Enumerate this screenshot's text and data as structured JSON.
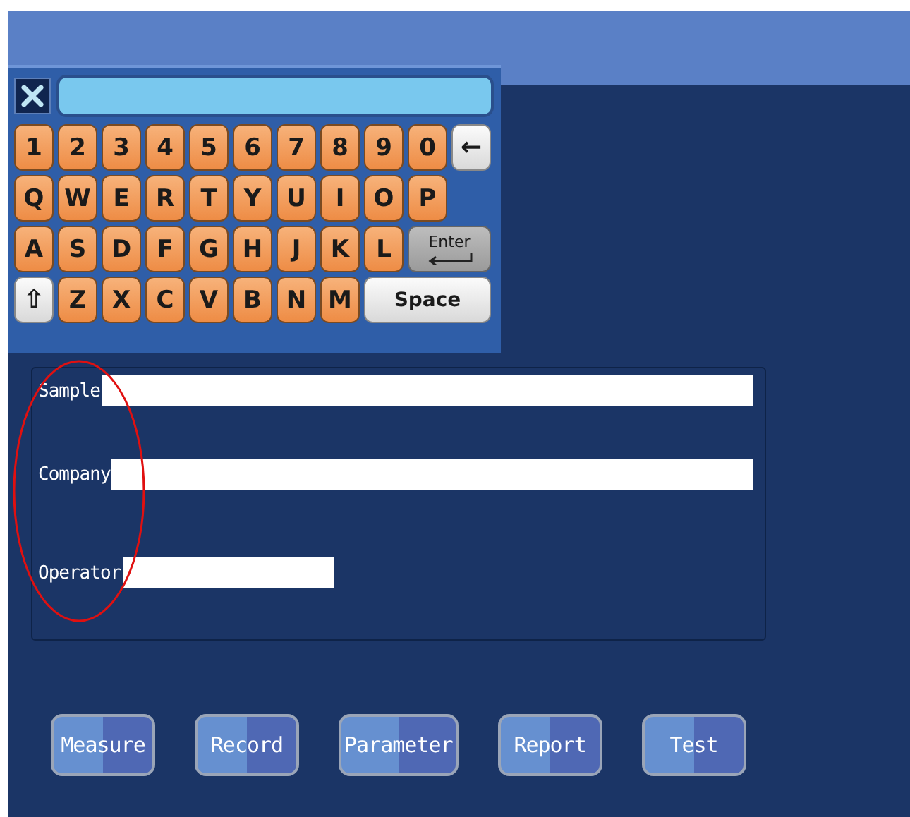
{
  "keyboard": {
    "key_rows": [
      [
        {
          "label": "1",
          "kind": "char"
        },
        {
          "label": "2",
          "kind": "char"
        },
        {
          "label": "3",
          "kind": "char"
        },
        {
          "label": "4",
          "kind": "char"
        },
        {
          "label": "5",
          "kind": "char"
        },
        {
          "label": "6",
          "kind": "char"
        },
        {
          "label": "7",
          "kind": "char"
        },
        {
          "label": "8",
          "kind": "char"
        },
        {
          "label": "9",
          "kind": "char"
        },
        {
          "label": "0",
          "kind": "char"
        },
        {
          "label": "←",
          "kind": "backspace"
        }
      ],
      [
        {
          "label": "Q",
          "kind": "char"
        },
        {
          "label": "W",
          "kind": "char"
        },
        {
          "label": "E",
          "kind": "char"
        },
        {
          "label": "R",
          "kind": "char"
        },
        {
          "label": "T",
          "kind": "char"
        },
        {
          "label": "Y",
          "kind": "char"
        },
        {
          "label": "U",
          "kind": "char"
        },
        {
          "label": "I",
          "kind": "char"
        },
        {
          "label": "O",
          "kind": "char"
        },
        {
          "label": "P",
          "kind": "char"
        }
      ],
      [
        {
          "label": "A",
          "kind": "char"
        },
        {
          "label": "S",
          "kind": "char"
        },
        {
          "label": "D",
          "kind": "char"
        },
        {
          "label": "F",
          "kind": "char"
        },
        {
          "label": "G",
          "kind": "char"
        },
        {
          "label": "H",
          "kind": "char"
        },
        {
          "label": "J",
          "kind": "char"
        },
        {
          "label": "K",
          "kind": "char"
        },
        {
          "label": "L",
          "kind": "char"
        },
        {
          "label": "Enter",
          "kind": "enter"
        }
      ],
      [
        {
          "label": "⇧",
          "kind": "shift"
        },
        {
          "label": "Z",
          "kind": "char"
        },
        {
          "label": "X",
          "kind": "char"
        },
        {
          "label": "C",
          "kind": "char"
        },
        {
          "label": "V",
          "kind": "char"
        },
        {
          "label": "B",
          "kind": "char"
        },
        {
          "label": "N",
          "kind": "char"
        },
        {
          "label": "M",
          "kind": "char"
        },
        {
          "label": "Space",
          "kind": "space"
        }
      ]
    ]
  },
  "form": {
    "fields": [
      {
        "label": "Sample",
        "kind": "long"
      },
      {
        "label": "Company",
        "kind": "long"
      },
      {
        "label": "Operator",
        "kind": "short"
      }
    ]
  },
  "buttons": [
    "Measure",
    "Record",
    "Parameter",
    "Report",
    "Test"
  ]
}
